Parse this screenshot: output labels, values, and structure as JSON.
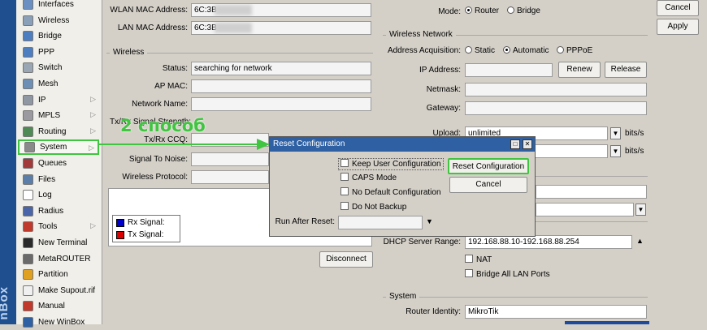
{
  "brand": {
    "strip_text": "nBox"
  },
  "menu": {
    "items": [
      {
        "label": "Interfaces",
        "icon": "interfaces-icon",
        "color": "#6a8fc0",
        "arrow": ""
      },
      {
        "label": "Wireless",
        "icon": "wireless-icon",
        "color": "#8aa0b8",
        "arrow": ""
      },
      {
        "label": "Bridge",
        "icon": "bridge-icon",
        "color": "#4d7ec0",
        "arrow": ""
      },
      {
        "label": "PPP",
        "icon": "ppp-icon",
        "color": "#4d7ec0",
        "arrow": ""
      },
      {
        "label": "Switch",
        "icon": "switch-icon",
        "color": "#9aa6b3",
        "arrow": ""
      },
      {
        "label": "Mesh",
        "icon": "mesh-icon",
        "color": "#6d8fb5",
        "arrow": ""
      },
      {
        "label": "IP",
        "icon": "ip-icon",
        "color": "#8f97a3",
        "arrow": "▷"
      },
      {
        "label": "MPLS",
        "icon": "mpls-icon",
        "color": "#9a9aa0",
        "arrow": "▷"
      },
      {
        "label": "Routing",
        "icon": "routing-icon",
        "color": "#4f8a54",
        "arrow": "▷"
      },
      {
        "label": "System",
        "icon": "gear-icon",
        "color": "#8a8a8a",
        "arrow": "▷"
      },
      {
        "label": "Queues",
        "icon": "queues-icon",
        "color": "#a23a3a",
        "arrow": ""
      },
      {
        "label": "Files",
        "icon": "folder-icon",
        "color": "#5b7ea8",
        "arrow": ""
      },
      {
        "label": "Log",
        "icon": "log-icon",
        "color": "#ffffff",
        "arrow": ""
      },
      {
        "label": "Radius",
        "icon": "radius-icon",
        "color": "#4b66a8",
        "arrow": ""
      },
      {
        "label": "Tools",
        "icon": "tools-icon",
        "color": "#c0392b",
        "arrow": "▷"
      },
      {
        "label": "New Terminal",
        "icon": "terminal-icon",
        "color": "#2a2a2a",
        "arrow": ""
      },
      {
        "label": "MetaROUTER",
        "icon": "metarouter-icon",
        "color": "#6a6a6a",
        "arrow": ""
      },
      {
        "label": "Partition",
        "icon": "partition-icon",
        "color": "#e0a020",
        "arrow": ""
      },
      {
        "label": "Make Supout.rif",
        "icon": "supout-icon",
        "color": "#f0f0f0",
        "arrow": ""
      },
      {
        "label": "Manual",
        "icon": "manual-icon",
        "color": "#c0392b",
        "arrow": ""
      },
      {
        "label": "New WinBox",
        "icon": "winbox-icon",
        "color": "#2e60a3",
        "arrow": ""
      }
    ]
  },
  "left_panel": {
    "wlan_mac_label": "WLAN MAC Address:",
    "wlan_mac_value": "6C:3B",
    "lan_mac_label": "LAN MAC Address:",
    "lan_mac_value": "6C:3B",
    "wireless_group": "Wireless",
    "status_label": "Status:",
    "status_value": "searching for network",
    "ap_mac_label": "AP MAC:",
    "network_name_label": "Network Name:",
    "txrx_signal_label": "Tx/Rx Signal Strength:",
    "txrx_ccq_label": "Tx/Rx CCQ:",
    "signal_noise_label": "Signal To Noise:",
    "wireless_protocol_label": "Wireless Protocol:",
    "legend_rx": "Rx Signal:",
    "legend_tx": "Tx Signal:",
    "rx_color": "#0000cc",
    "tx_color": "#dd0000",
    "disconnect_button": "Disconnect"
  },
  "annotation": {
    "text": "2 способ",
    "color": "#3fc53f"
  },
  "right_panel": {
    "mode_label": "Mode:",
    "mode_router": "Router",
    "mode_bridge": "Bridge",
    "wireless_network_group": "Wireless Network",
    "address_acq_label": "Address Acquisition:",
    "acq_static": "Static",
    "acq_automatic": "Automatic",
    "acq_pppoe": "PPPoE",
    "ip_address_label": "IP Address:",
    "renew_button": "Renew",
    "release_button": "Release",
    "netmask_label": "Netmask:",
    "gateway_label": "Gateway:",
    "upload_label": "Upload:",
    "upload_value": "unlimited",
    "bits_unit": "bits/s",
    "dhcp_range_label": "DHCP Server Range:",
    "dhcp_range_value": "192.168.88.10-192.168.88.254",
    "nat_label": "NAT",
    "bridge_lan_label": "Bridge All LAN Ports",
    "system_group": "System",
    "router_identity_label": "Router Identity:",
    "router_identity_value": "MikroTik",
    "cancel_button": "Cancel",
    "apply_button": "Apply"
  },
  "dialog": {
    "title": "Reset Configuration",
    "keep_user_config": "Keep User Configuration",
    "caps_mode": "CAPS Mode",
    "no_default_config": "No Default Configuration",
    "do_not_backup": "Do Not Backup",
    "run_after_reset_label": "Run After Reset:",
    "reset_button": "Reset Configuration",
    "cancel_button": "Cancel",
    "title_bar_color": "#2e60a3"
  }
}
